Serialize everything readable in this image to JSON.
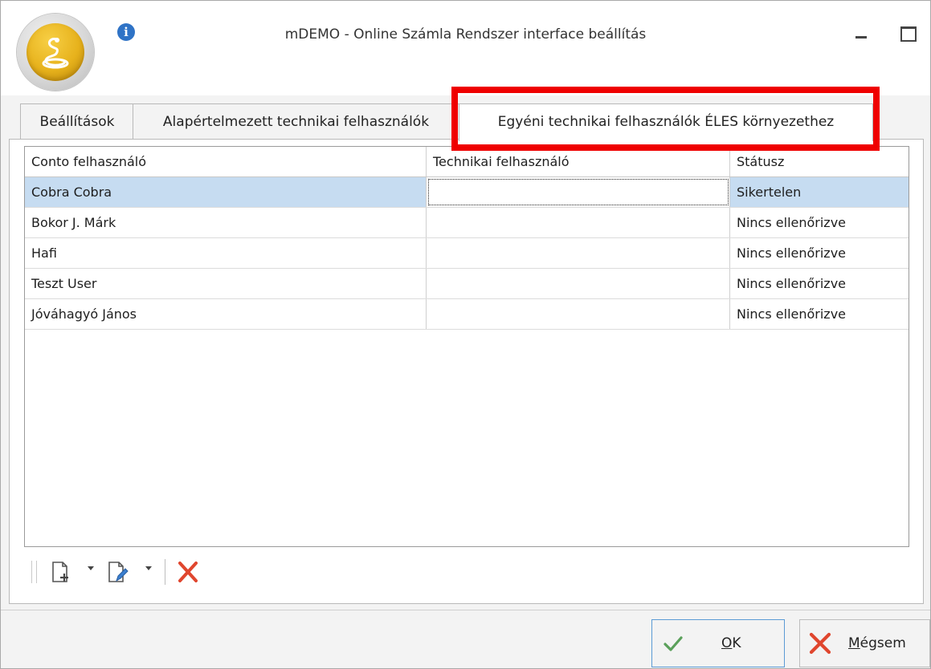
{
  "window": {
    "title": "mDEMO - Online Számla Rendszer interface beállítás"
  },
  "icons": {
    "logo": "cobra-logo-icon",
    "info": "info-icon",
    "minimize": "minimize-icon",
    "maximize": "maximize-icon",
    "add": "add-document-icon",
    "edit": "edit-document-icon",
    "delete": "delete-x-icon",
    "ok": "checkmark-icon",
    "cancel": "cancel-x-icon"
  },
  "tabs": [
    {
      "label": "Beállítások",
      "active": false
    },
    {
      "label": "Alapértelmezett technikai felhasználók",
      "active": false
    },
    {
      "label": "Egyéni technikai felhasználók ÉLES környezethez",
      "active": true
    }
  ],
  "grid": {
    "columns": [
      "Conto felhasználó",
      "Technikai felhasználó",
      "Státusz"
    ],
    "rows": [
      {
        "user": "Cobra Cobra",
        "tech": "",
        "status": "Sikertelen",
        "selected": true
      },
      {
        "user": "Bokor J. Márk",
        "tech": "",
        "status": "Nincs ellenőrizve"
      },
      {
        "user": "Hafi",
        "tech": "",
        "status": "Nincs ellenőrizve"
      },
      {
        "user": "Teszt User",
        "tech": "",
        "status": "Nincs ellenőrizve"
      },
      {
        "user": "Jóváhagyó János",
        "tech": "",
        "status": "Nincs ellenőrizve"
      }
    ]
  },
  "buttons": {
    "ok_mnemonic": "O",
    "ok_rest": "K",
    "cancel_mnemonic": "M",
    "cancel_rest": "égsem"
  },
  "colors": {
    "highlight": "#ef0000",
    "selected_row": "#c6dcf1",
    "ok_check": "#5aa05a",
    "delete_red": "#e0462e"
  }
}
